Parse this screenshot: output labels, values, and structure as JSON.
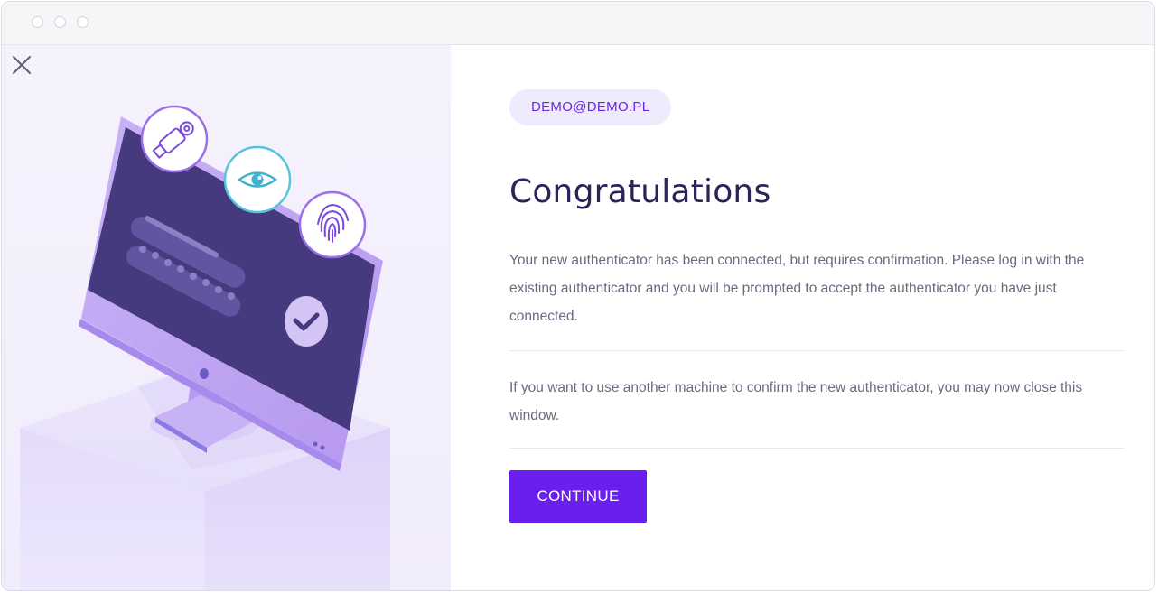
{
  "user": {
    "email": "DEMO@DEMO.PL"
  },
  "main": {
    "title": "Congratulations",
    "message_primary": "Your new authenticator has been connected, but requires confirmation. Please log in with the existing authenticator and you will be prompted to accept the authenticator you have just connected.",
    "message_secondary": "If you want to use another machine to confirm the new authenticator, you may now close this window.",
    "continue_label": "CONTINUE"
  },
  "illustration": {
    "badges": [
      "usb-key-icon",
      "eye-icon",
      "fingerprint-icon"
    ],
    "screen_check": "checkmark-icon"
  },
  "colors": {
    "accent": "#6a1ff0",
    "badge_bg": "#efeafc",
    "title": "#2a2458",
    "body_text": "#6b6a80",
    "screen": "#453a7e"
  }
}
